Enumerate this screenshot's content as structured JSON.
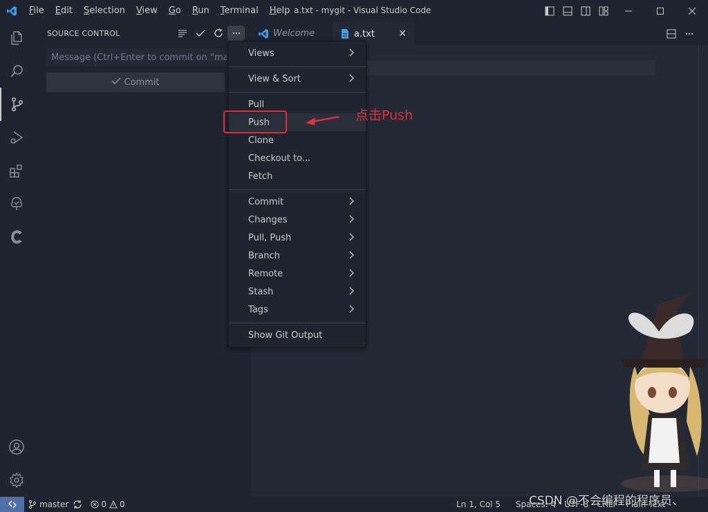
{
  "window": {
    "title": "a.txt - mygit - Visual Studio Code"
  },
  "menubar": {
    "items": [
      {
        "mnemonic": "F",
        "rest": "ile"
      },
      {
        "mnemonic": "E",
        "rest": "dit"
      },
      {
        "mnemonic": "S",
        "rest": "election"
      },
      {
        "mnemonic": "V",
        "rest": "iew"
      },
      {
        "mnemonic": "G",
        "rest": "o"
      },
      {
        "mnemonic": "R",
        "rest": "un"
      },
      {
        "mnemonic": "T",
        "rest": "erminal"
      },
      {
        "mnemonic": "H",
        "rest": "elp"
      }
    ]
  },
  "activitybar": {
    "items": [
      "explorer-icon",
      "search-icon",
      "source-control-icon",
      "run-debug-icon",
      "extensions-icon",
      "remote-tree-icon",
      "c-extension-icon"
    ],
    "active": "source-control-icon",
    "bottom": [
      "account-icon",
      "manage-gear-icon"
    ]
  },
  "sidebar": {
    "title": "SOURCE CONTROL",
    "commit_placeholder": "Message (Ctrl+Enter to commit on \"master\")",
    "commit_label": "Commit"
  },
  "tabs": [
    {
      "label": "Welcome",
      "icon": "vscode-logo-icon",
      "active": false
    },
    {
      "label": "a.txt",
      "icon": "file-icon",
      "active": true,
      "close": "✕"
    }
  ],
  "menu": {
    "items": [
      {
        "label": "Views",
        "submenu": true
      },
      {
        "label": "View & Sort",
        "submenu": true
      },
      {
        "label": "Pull",
        "submenu": false
      },
      {
        "label": "Push",
        "submenu": false
      },
      {
        "label": "Clone",
        "submenu": false
      },
      {
        "label": "Checkout to...",
        "submenu": false
      },
      {
        "label": "Fetch",
        "submenu": false
      },
      {
        "label": "Commit",
        "submenu": true
      },
      {
        "label": "Changes",
        "submenu": true
      },
      {
        "label": "Pull, Push",
        "submenu": true
      },
      {
        "label": "Branch",
        "submenu": true
      },
      {
        "label": "Remote",
        "submenu": true
      },
      {
        "label": "Stash",
        "submenu": true
      },
      {
        "label": "Tags",
        "submenu": true
      },
      {
        "label": "Show Git Output",
        "submenu": false
      }
    ],
    "hovered": "Push"
  },
  "annotation": {
    "text": "点击Push",
    "color": "#e0303a"
  },
  "statusbar": {
    "branch": "master",
    "errors": "0",
    "warnings": "0",
    "position": "Ln 1, Col 5",
    "spaces": "Spaces: 4",
    "encoding": "UTF-8",
    "eol": "CRLF",
    "language": "Plain Text"
  },
  "watermark": "CSDN @不会编程的程序员、",
  "colors": {
    "background": "#1f2430",
    "editor": "#242936",
    "accent": "#4f6fa8",
    "foreground": "#cbccc6"
  }
}
